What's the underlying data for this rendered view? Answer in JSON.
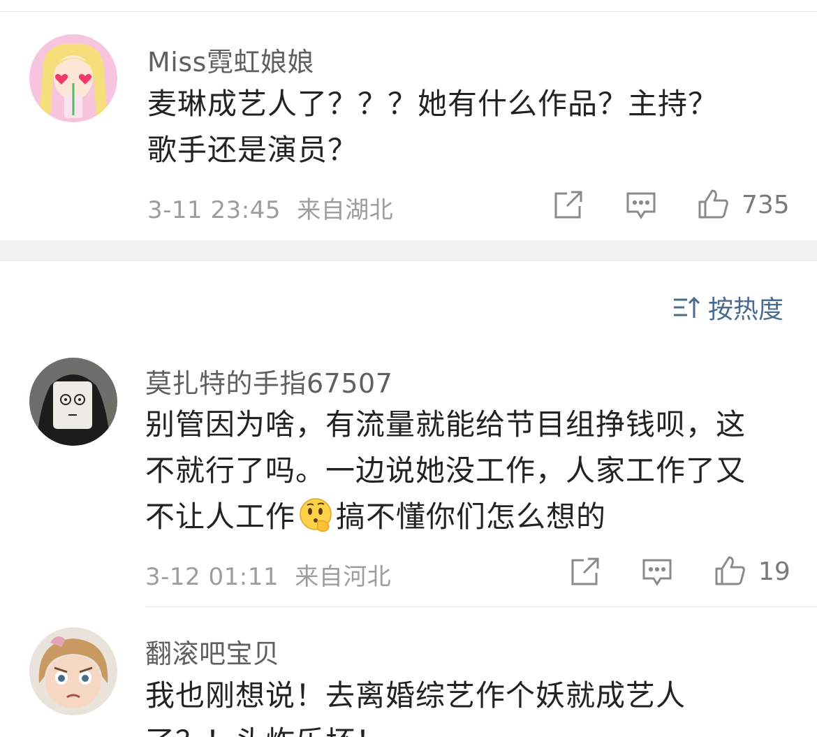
{
  "comments": [
    {
      "username": "Miss霓虹娘娘",
      "text_lines": [
        "麦琳成艺人了？？？她有什么作品？主持？",
        "歌手还是演员？"
      ],
      "date": "3-11 23:45",
      "location": "来自湖北",
      "likes": "735",
      "avatar_icon": "sailor-moon-cartoon-avatar"
    },
    {
      "username": "莫扎特的手指67507",
      "text_lines": [
        "别管因为啥，有流量就能给节目组挣钱呗，这",
        "不就行了吗。一边说她没工作，人家工作了又"
      ],
      "text_line3_before": "不让人工作",
      "text_line3_after": "搞不懂你们怎么想的",
      "inline_emoji_icon": "thinking-face-emoji",
      "date": "3-12 01:11",
      "location": "来自河北",
      "likes": "19",
      "avatar_icon": "masked-figure-avatar"
    },
    {
      "username": "翻滚吧宝贝",
      "text_lines": [
        "我也刚想说！去离婚综艺作个妖就成艺人",
        "了？！头炸乐坏！"
      ],
      "avatar_icon": "cartoon-girl-avatar"
    }
  ],
  "sort": {
    "label": "按热度",
    "icon": "sort-icon"
  },
  "colors": {
    "text": "#222222",
    "username": "#5f5f5f",
    "meta": "#9d9d9d",
    "accent": "#4a6a90",
    "divider": "#f1f1f1"
  }
}
